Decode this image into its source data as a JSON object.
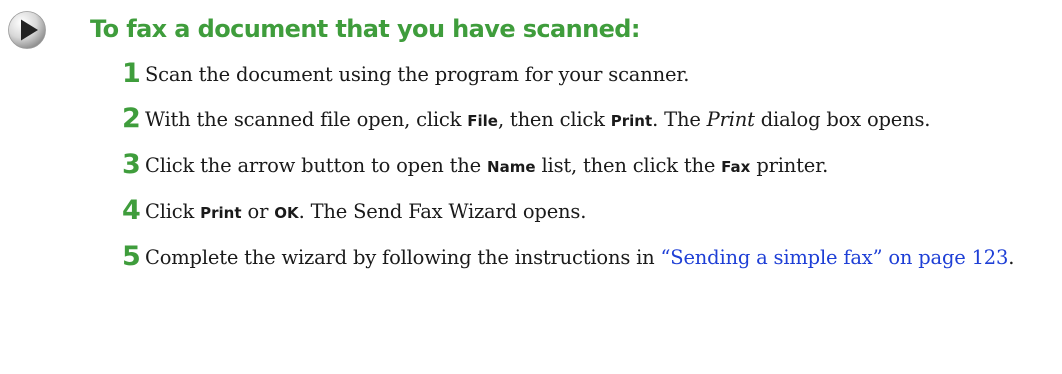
{
  "heading": "To fax a document that you have scanned:",
  "colors": {
    "accent_green": "#3f9d3c",
    "link_blue": "#1e3fd6",
    "icon_dark": "#222222"
  },
  "icons": {
    "section_marker": "play-triangle-icon"
  },
  "steps": [
    {
      "number": "1",
      "text": "Scan the document using the program for your scanner."
    },
    {
      "number": "2",
      "t1": "With the scanned file open, click ",
      "b1": "File",
      "t2": ", then click ",
      "b2": "Print",
      "t3": ". The ",
      "i1": "Print",
      "t4": " dialog box opens."
    },
    {
      "number": "3",
      "t1": "Click the arrow button to open the ",
      "b1": "Name",
      "t2": " list, then click the ",
      "b2": "Fax",
      "t3": " printer."
    },
    {
      "number": "4",
      "t1": "Click ",
      "b1": "Print",
      "t2": " or ",
      "b2": "OK",
      "t3": ". The Send Fax Wizard opens."
    },
    {
      "number": "5",
      "t1": "Complete the wizard by following the instructions in ",
      "link": "“Sending a simple fax” on page 123",
      "t2": "."
    }
  ]
}
